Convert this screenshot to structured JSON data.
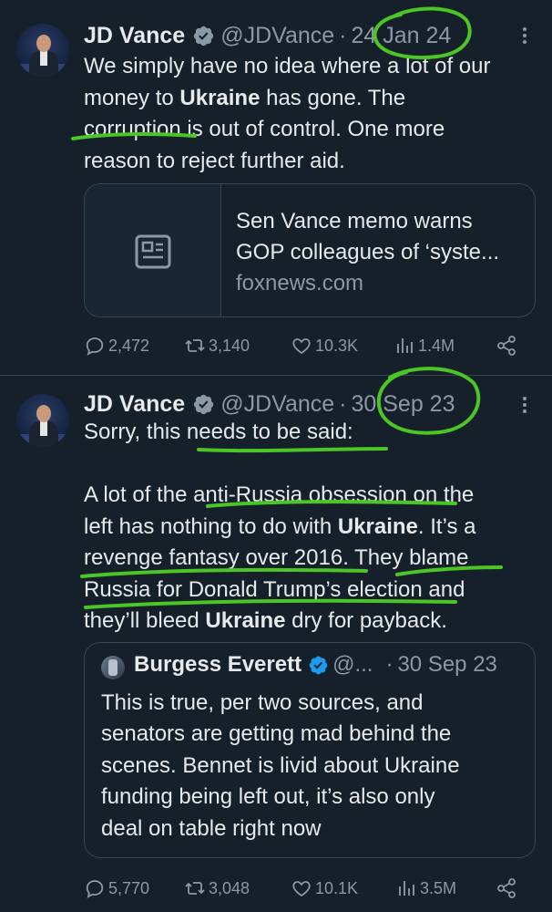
{
  "tweets": [
    {
      "author": "JD Vance",
      "handle": "@JDVance",
      "separator": "·",
      "date": "24 Jan 24",
      "lines": [
        [
          {
            "t": "We simply have no idea where a lot of our"
          }
        ],
        [
          {
            "t": "money to "
          },
          {
            "t": "Ukraine",
            "b": true
          },
          {
            "t": " has gone. The"
          }
        ],
        [
          {
            "t": "corruption is out of control. One more"
          }
        ],
        [
          {
            "t": "reason to reject further aid."
          }
        ]
      ],
      "card": {
        "title": "Sen Vance memo warns",
        "subtitle": "GOP colleagues of ‘syste...",
        "domain": "foxnews.com",
        "icon": "article-icon"
      },
      "metrics": {
        "replies": "2,472",
        "retweets": "3,140",
        "likes": "10.3K",
        "views": "1.4M"
      }
    },
    {
      "author": "JD Vance",
      "handle": "@JDVance",
      "separator": "·",
      "date": "30 Sep 23",
      "lines": [
        [
          {
            "t": "Sorry, this needs to be said:"
          }
        ],
        [
          {
            "t": ""
          }
        ],
        [
          {
            "t": "A lot of the anti-Russia obsession on the"
          }
        ],
        [
          {
            "t": "left has nothing to do with "
          },
          {
            "t": "Ukraine",
            "b": true
          },
          {
            "t": ". It’s a"
          }
        ],
        [
          {
            "t": "revenge fantasy over 2016. They blame"
          }
        ],
        [
          {
            "t": "Russia for Donald Trump’s election and"
          }
        ],
        [
          {
            "t": "they’ll bleed "
          },
          {
            "t": "Ukraine",
            "b": true
          },
          {
            "t": " dry for payback."
          }
        ]
      ],
      "quote": {
        "author": "Burgess Everett",
        "handle": "@...",
        "separator": "·",
        "date": "30 Sep 23",
        "lines": [
          "This is true, per two sources,  and",
          "senators are getting mad behind the",
          "scenes. Bennet is livid about Ukraine",
          "funding being left out, it’s also only",
          "deal on table right now"
        ]
      },
      "metrics": {
        "replies": "5,770",
        "retweets": "3,048",
        "likes": "10.1K",
        "views": "3.5M"
      }
    }
  ],
  "colors": {
    "background": "#15202b",
    "text": "#e7e9ea",
    "muted": "#8b98a5",
    "border": "#38444d",
    "verified": "#1d9bf0",
    "annotation": "#4cc626"
  },
  "icons": [
    "verified-badge-icon",
    "more-icon",
    "reply-icon",
    "retweet-icon",
    "like-icon",
    "views-icon",
    "share-icon",
    "article-icon"
  ]
}
